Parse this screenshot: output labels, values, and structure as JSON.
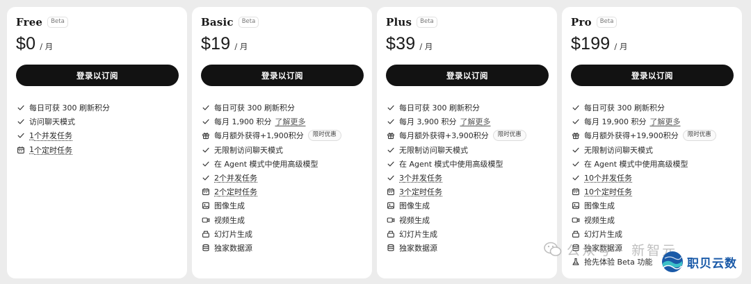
{
  "subscribe_label": "登录以订阅",
  "period": "/ 月",
  "beta_badge": "Beta",
  "watermark": {
    "text": "公众号 · 新智元"
  },
  "brand": {
    "text": "职贝云数",
    "color": "#1a5aa8"
  },
  "plans": [
    {
      "name": "Free",
      "price": "$0",
      "features": [
        {
          "icon": "check-icon",
          "text": "每日可获 300 刷新积分"
        },
        {
          "icon": "check-icon",
          "text": "访问聊天模式"
        },
        {
          "icon": "check-icon",
          "num": "1",
          "rest": "个并发任务"
        },
        {
          "icon": "calendar-icon",
          "num": "1",
          "rest": "个定时任务"
        }
      ]
    },
    {
      "name": "Basic",
      "price": "$19",
      "features": [
        {
          "icon": "check-icon",
          "text": "每日可获 300 刷新积分"
        },
        {
          "icon": "check-icon",
          "text": "每月 1,900 积分",
          "link": "了解更多"
        },
        {
          "icon": "gift-icon",
          "text": "每月额外获得+1,900积分",
          "tag": "限时优惠"
        },
        {
          "icon": "check-icon",
          "text": "无限制访问聊天模式"
        },
        {
          "icon": "check-icon",
          "text": "在 Agent 模式中使用高级模型"
        },
        {
          "icon": "check-icon",
          "num": "2",
          "rest": " 个并发任务"
        },
        {
          "icon": "calendar-icon",
          "num": "2",
          "rest": " 个定时任务"
        },
        {
          "icon": "image-icon",
          "text": "图像生成"
        },
        {
          "icon": "video-icon",
          "text": "视频生成"
        },
        {
          "icon": "slides-icon",
          "text": "幻灯片生成"
        },
        {
          "icon": "database-icon",
          "text": "独家数据源"
        }
      ]
    },
    {
      "name": "Plus",
      "price": "$39",
      "features": [
        {
          "icon": "check-icon",
          "text": "每日可获 300 刷新积分"
        },
        {
          "icon": "check-icon",
          "text": "每月 3,900 积分",
          "link": "了解更多"
        },
        {
          "icon": "gift-icon",
          "text": "每月额外获得+3,900积分",
          "tag": "限时优惠"
        },
        {
          "icon": "check-icon",
          "text": "无限制访问聊天模式"
        },
        {
          "icon": "check-icon",
          "text": "在 Agent 模式中使用高级模型"
        },
        {
          "icon": "check-icon",
          "num": "3",
          "rest": " 个并发任务"
        },
        {
          "icon": "calendar-icon",
          "num": "3",
          "rest": " 个定时任务"
        },
        {
          "icon": "image-icon",
          "text": "图像生成"
        },
        {
          "icon": "video-icon",
          "text": "视频生成"
        },
        {
          "icon": "slides-icon",
          "text": "幻灯片生成"
        },
        {
          "icon": "database-icon",
          "text": "独家数据源"
        }
      ]
    },
    {
      "name": "Pro",
      "price": "$199",
      "features": [
        {
          "icon": "check-icon",
          "text": "每日可获 300 刷新积分"
        },
        {
          "icon": "check-icon",
          "text": "每月 19,900 积分",
          "link": "了解更多"
        },
        {
          "icon": "gift-icon",
          "text": "每月额外获得+19,900积分",
          "tag": "限时优惠"
        },
        {
          "icon": "check-icon",
          "text": "无限制访问聊天模式"
        },
        {
          "icon": "check-icon",
          "text": "在 Agent 模式中使用高级模型"
        },
        {
          "icon": "check-icon",
          "num": "10",
          "rest": " 个并发任务"
        },
        {
          "icon": "calendar-icon",
          "num": "10",
          "rest": " 个定时任务"
        },
        {
          "icon": "image-icon",
          "text": "图像生成"
        },
        {
          "icon": "video-icon",
          "text": "视频生成"
        },
        {
          "icon": "slides-icon",
          "text": "幻灯片生成"
        },
        {
          "icon": "database-icon",
          "text": "独家数据源"
        },
        {
          "icon": "flask-icon",
          "text": "抢先体验 Beta 功能"
        }
      ]
    }
  ]
}
